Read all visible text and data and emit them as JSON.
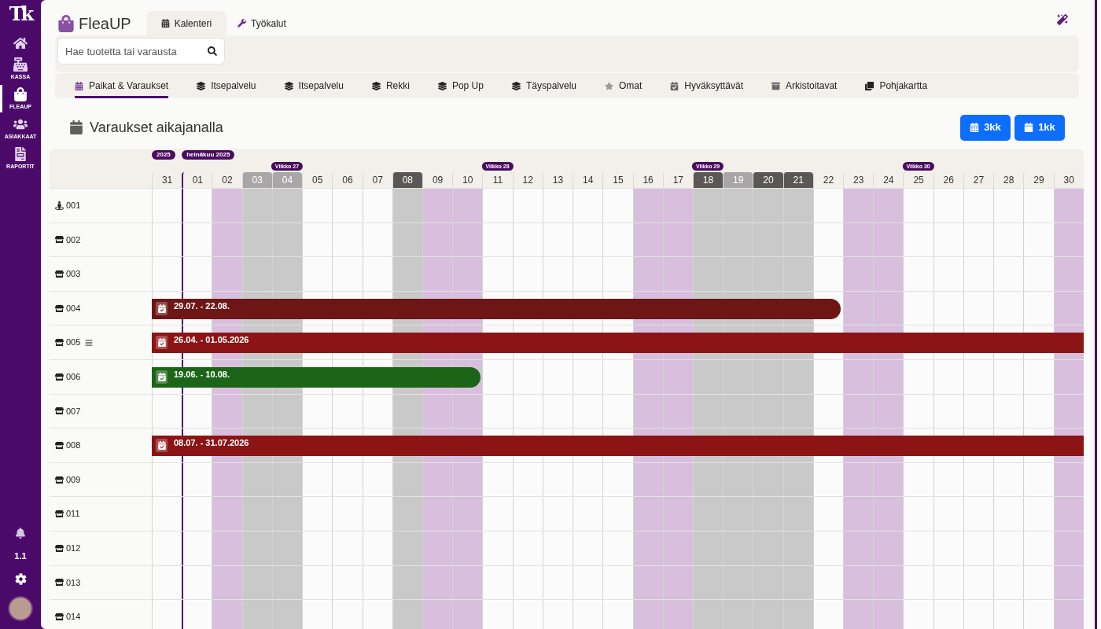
{
  "sidebar": {
    "logo": "Tk",
    "items": [
      {
        "selected": false
      },
      {
        "label": "KASSA",
        "selected": false
      },
      {
        "label": "FLEAUP",
        "selected": true
      },
      {
        "label": "ASIAKKAAT",
        "selected": false
      },
      {
        "label": "RAPORTIT",
        "selected": false
      }
    ],
    "footer_text": "1.1"
  },
  "header": {
    "brand": "FleaUP",
    "tabs": [
      {
        "label": "Kalenteri",
        "selected": true
      },
      {
        "label": "Työkalut",
        "selected": false
      }
    ]
  },
  "search": {
    "placeholder": "Hae tuotetta tai varausta"
  },
  "subtabs": [
    {
      "label": "Paikat & Varaukset",
      "selected": true
    },
    {
      "label": "Itsepalvelu",
      "selected": false
    },
    {
      "label": "Itsepalvelu",
      "selected": false
    },
    {
      "label": "Rekki",
      "selected": false
    },
    {
      "label": "Pop Up",
      "selected": false
    },
    {
      "label": "Täyspalvelu",
      "selected": false
    },
    {
      "label": "Omat",
      "selected": false
    },
    {
      "label": "Hyväksyttävät",
      "selected": false
    },
    {
      "label": "Arkistoitavat",
      "selected": false
    },
    {
      "label": "Pohjakartta",
      "selected": false
    }
  ],
  "section": {
    "title": "Varaukset aikajanalla",
    "buttons": [
      "3kk",
      "1kk"
    ]
  },
  "timeline": {
    "days": [
      {
        "label": "31",
        "kind": "plain",
        "today": false,
        "month_badge": "2025"
      },
      {
        "label": "01",
        "kind": "plain",
        "today": true,
        "month_badge": "heinäkuu 2025"
      },
      {
        "label": "02",
        "kind": "highlighted",
        "today": false
      },
      {
        "label": "03",
        "kind": "shaded",
        "today": false
      },
      {
        "label": "04",
        "kind": "shaded",
        "today": false,
        "week_badge": "Viikko 27"
      },
      {
        "label": "05",
        "kind": "plain",
        "today": false
      },
      {
        "label": "06",
        "kind": "plain",
        "today": false
      },
      {
        "label": "07",
        "kind": "plain",
        "today": false
      },
      {
        "label": "08",
        "kind": "dark",
        "today": false
      },
      {
        "label": "09",
        "kind": "highlighted",
        "today": false
      },
      {
        "label": "10",
        "kind": "highlighted",
        "today": false
      },
      {
        "label": "11",
        "kind": "plain",
        "today": false,
        "week_badge": "Viikko 28"
      },
      {
        "label": "12",
        "kind": "plain",
        "today": false
      },
      {
        "label": "13",
        "kind": "plain",
        "today": false
      },
      {
        "label": "14",
        "kind": "plain",
        "today": false
      },
      {
        "label": "15",
        "kind": "plain",
        "today": false
      },
      {
        "label": "16",
        "kind": "highlighted",
        "today": false
      },
      {
        "label": "17",
        "kind": "highlighted",
        "today": false
      },
      {
        "label": "18",
        "kind": "dark",
        "today": false,
        "week_badge": "Viikko 29"
      },
      {
        "label": "19",
        "kind": "shaded",
        "today": false
      },
      {
        "label": "20",
        "kind": "dark",
        "today": false
      },
      {
        "label": "21",
        "kind": "dark",
        "today": false
      },
      {
        "label": "22",
        "kind": "plain",
        "today": false
      },
      {
        "label": "23",
        "kind": "highlighted",
        "today": false
      },
      {
        "label": "24",
        "kind": "highlighted",
        "today": false
      },
      {
        "label": "25",
        "kind": "plain",
        "today": false,
        "week_badge": "Viikko 30"
      },
      {
        "label": "26",
        "kind": "plain",
        "today": false
      },
      {
        "label": "27",
        "kind": "plain",
        "today": false
      },
      {
        "label": "28",
        "kind": "plain",
        "today": false
      },
      {
        "label": "29",
        "kind": "plain",
        "today": false
      },
      {
        "label": "30",
        "kind": "highlighted",
        "today": false
      }
    ],
    "rows": [
      {
        "label": "001",
        "kind": "person",
        "notes": false
      },
      {
        "label": "002",
        "kind": "shop",
        "notes": false
      },
      {
        "label": "003",
        "kind": "shop",
        "notes": false
      },
      {
        "label": "004",
        "kind": "shop",
        "notes": false,
        "booking": {
          "dates": "29.07. - 22.08.",
          "color": "#6e1616",
          "level": 0.739
        }
      },
      {
        "label": "005",
        "kind": "shop",
        "notes": true,
        "booking": {
          "dates": "26.04. - 01.05.2026",
          "color": "#8c1414",
          "level": 1
        }
      },
      {
        "label": "006",
        "kind": "shop",
        "notes": false,
        "booking": {
          "dates": "19.06. - 10.08.",
          "color": "#1b6418",
          "level": 0.353
        }
      },
      {
        "label": "007",
        "kind": "shop",
        "notes": false
      },
      {
        "label": "008",
        "kind": "shop",
        "notes": false,
        "booking": {
          "dates": "08.07. - 31.07.2026",
          "color": "#8c1414",
          "level": 1
        }
      },
      {
        "label": "009",
        "kind": "shop",
        "notes": false
      },
      {
        "label": "011",
        "kind": "shop",
        "notes": false
      },
      {
        "label": "012",
        "kind": "shop",
        "notes": false
      },
      {
        "label": "013",
        "kind": "shop",
        "notes": false
      },
      {
        "label": "014",
        "kind": "shop",
        "notes": false
      }
    ]
  }
}
